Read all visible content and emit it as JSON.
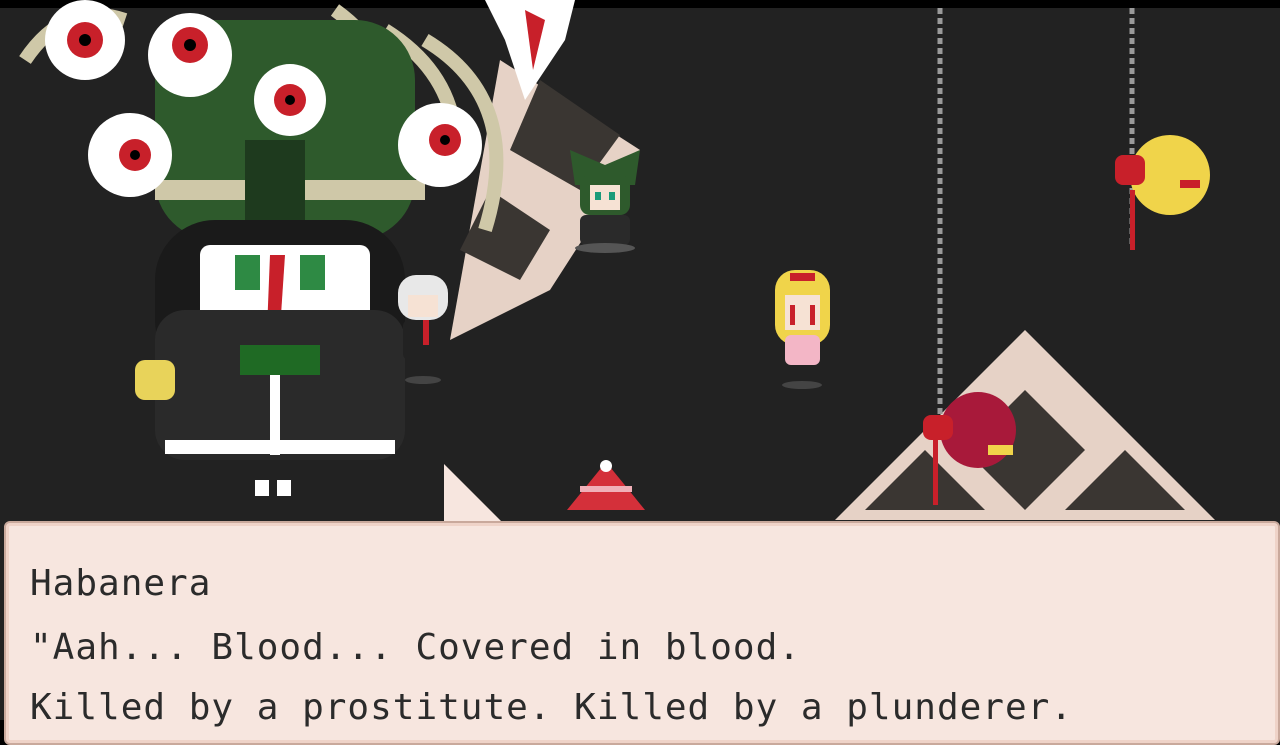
{
  "dialogue": {
    "speaker": "Habanera",
    "lines": [
      "\"Aah... Blood... Covered in blood.",
      "Killed by a prostitute. Killed by a plunderer."
    ]
  },
  "colors": {
    "background": "#222222",
    "dialog_bg": "#f7e6df",
    "blood": "#c8202a",
    "tile_light": "#e6d2c6",
    "tile_dark": "#3a3632"
  }
}
